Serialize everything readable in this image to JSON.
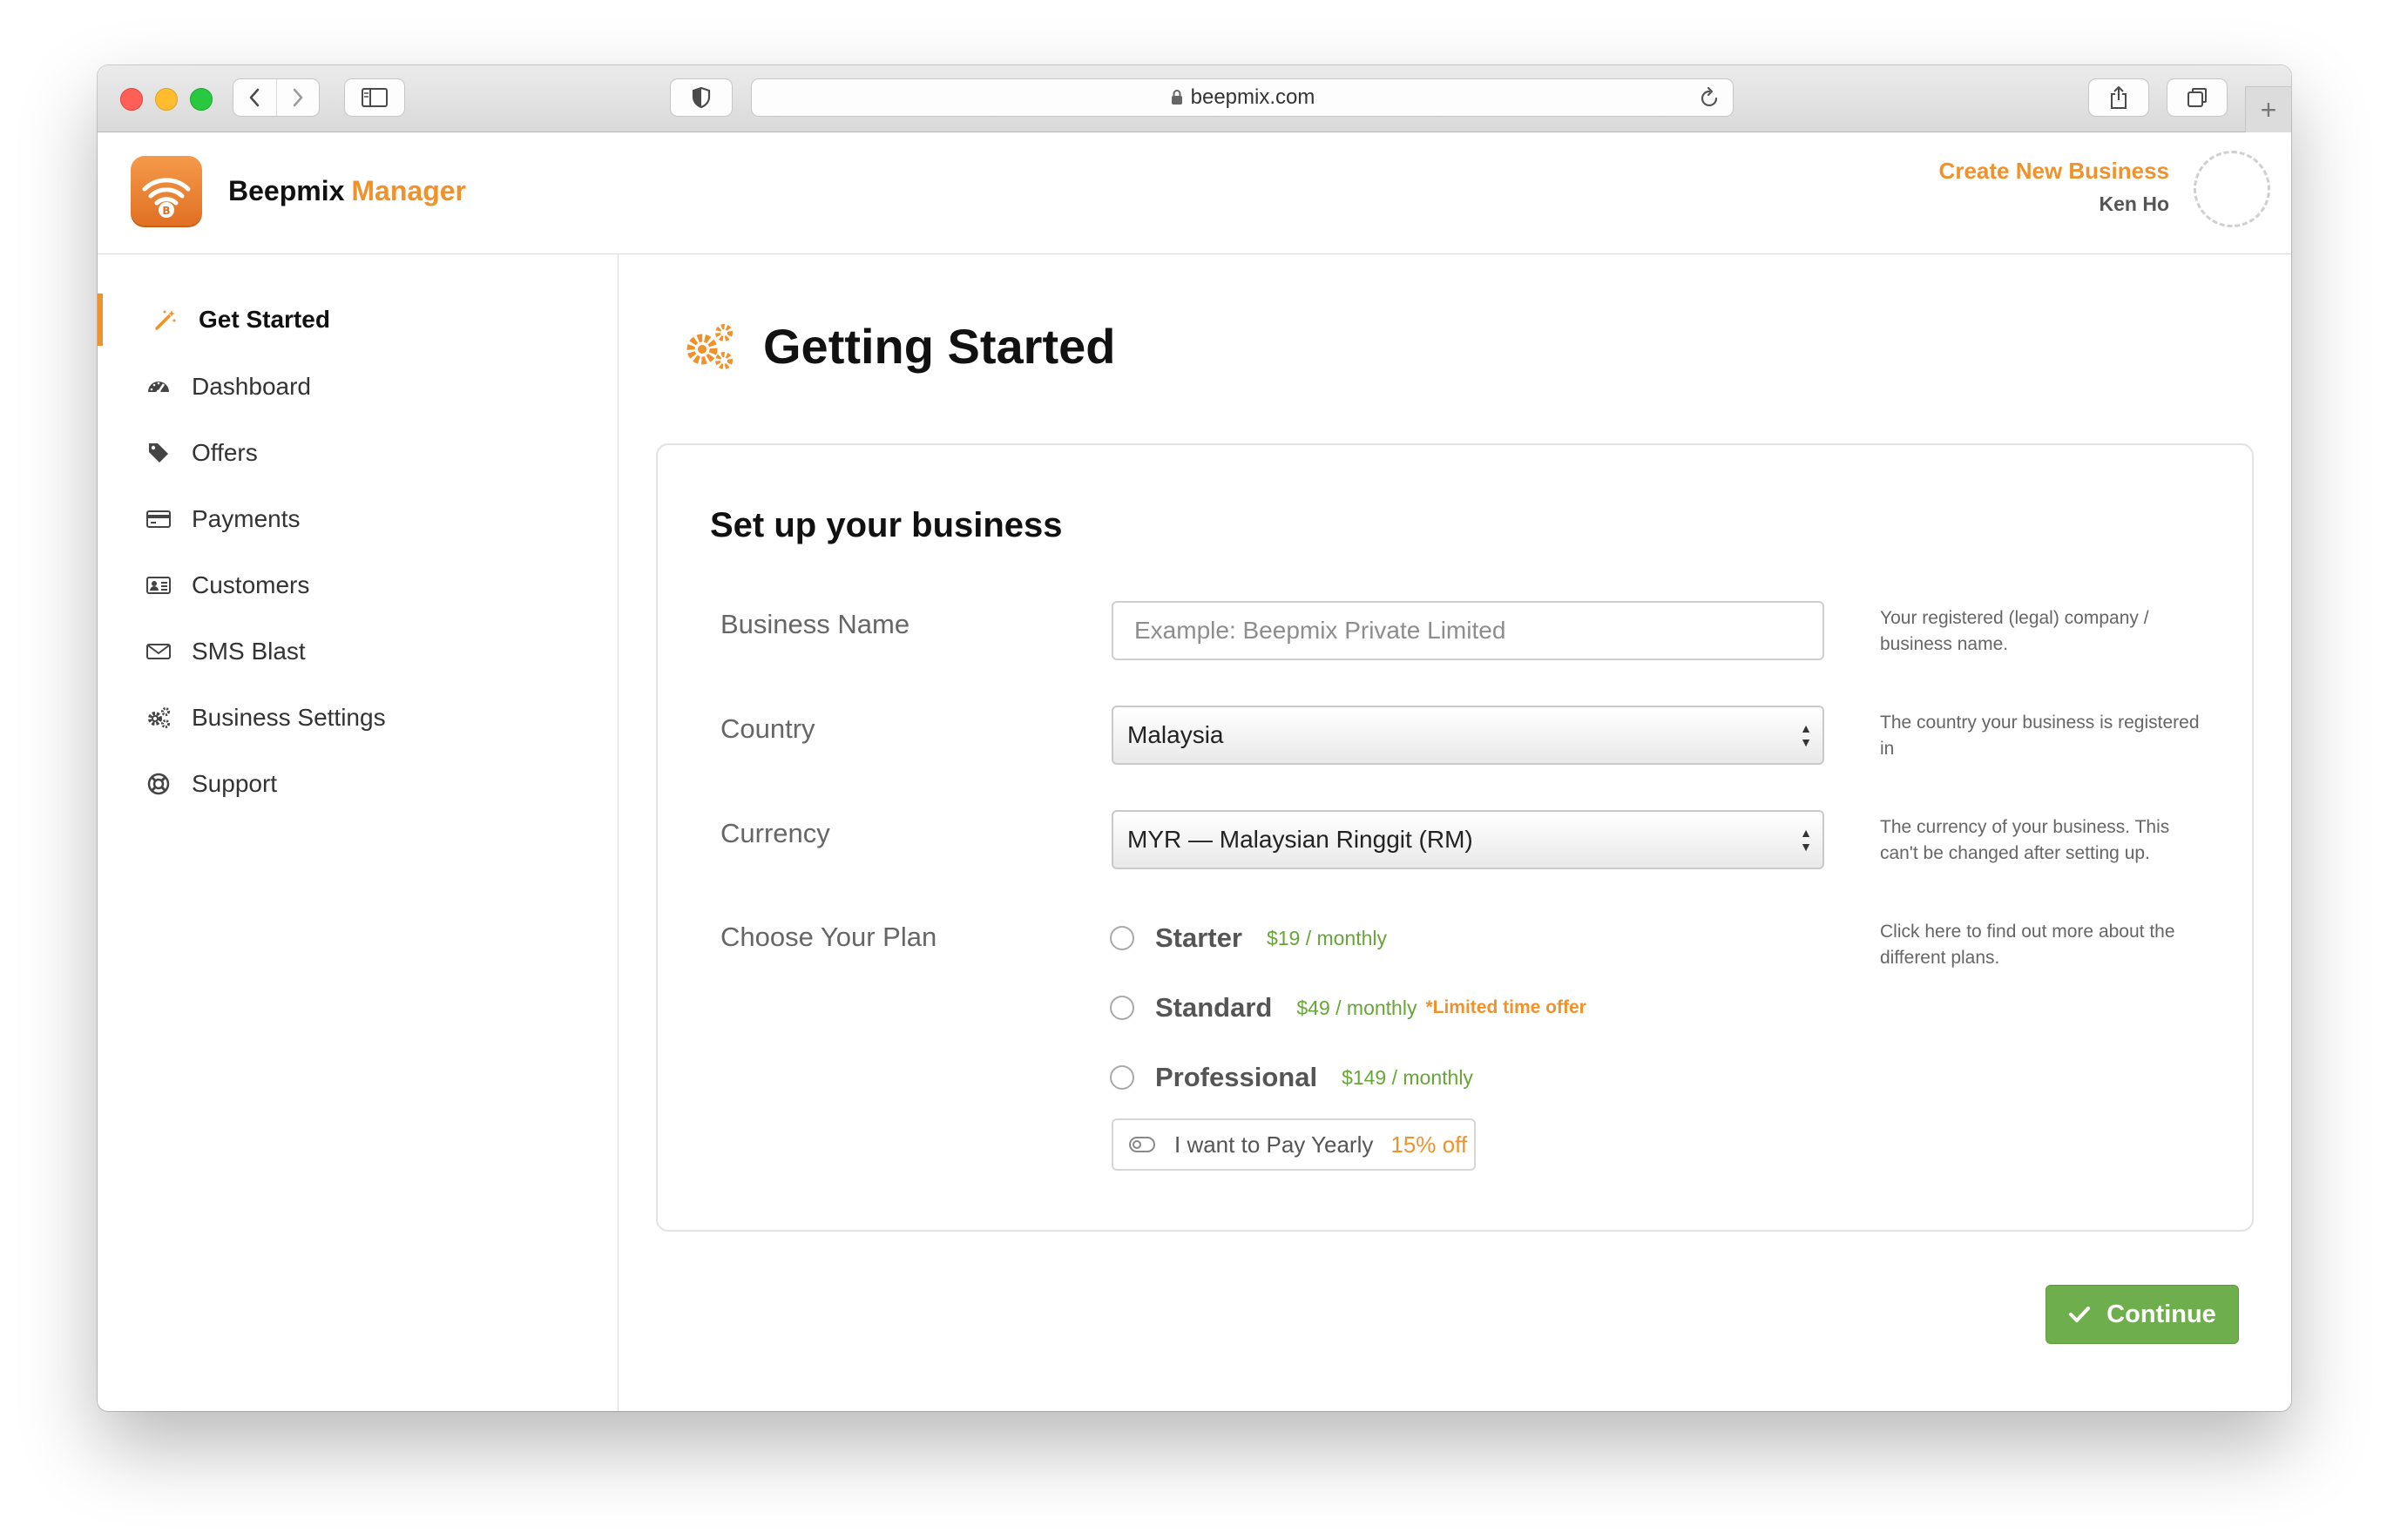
{
  "browser": {
    "url": "beepmix.com",
    "icons": {
      "back": "chevron-left-icon",
      "forward": "chevron-right-icon",
      "sidebar": "sidebar-icon",
      "privacy": "shield-icon",
      "lock": "lock-icon",
      "reload": "reload-icon",
      "share": "share-icon",
      "tabs": "tabs-icon",
      "new_tab": "plus-icon"
    }
  },
  "header": {
    "brand_name": "Beepmix",
    "brand_accent": "Manager",
    "create_business": "Create New Business",
    "user_name": "Ken Ho"
  },
  "sidebar": {
    "items": [
      {
        "label": "Get Started",
        "icon": "magic-wand-icon",
        "active": true
      },
      {
        "label": "Dashboard",
        "icon": "dashboard-gauge-icon"
      },
      {
        "label": "Offers",
        "icon": "tag-icon"
      },
      {
        "label": "Payments",
        "icon": "credit-card-icon"
      },
      {
        "label": "Customers",
        "icon": "id-card-icon"
      },
      {
        "label": "SMS Blast",
        "icon": "envelope-icon"
      },
      {
        "label": "Business Settings",
        "icon": "gears-icon"
      },
      {
        "label": "Support",
        "icon": "life-ring-icon"
      }
    ]
  },
  "main": {
    "title": "Getting Started",
    "card": {
      "title": "Set up your business",
      "business_name": {
        "label": "Business Name",
        "placeholder": "Example: Beepmix Private Limited",
        "value": "",
        "help": "Your registered (legal) company / business name."
      },
      "country": {
        "label": "Country",
        "value": "Malaysia",
        "help": "The country your business is registered in"
      },
      "currency": {
        "label": "Currency",
        "value": "MYR — Malaysian Ringgit (RM)",
        "help": "The currency of your business. This can't be changed after setting up."
      },
      "plan": {
        "label": "Choose Your Plan",
        "help": "Click here to find out more about the different plans.",
        "options": [
          {
            "name": "Starter",
            "price": "$19 / monthly",
            "offer": ""
          },
          {
            "name": "Standard",
            "price": "$49 / monthly",
            "offer": "*Limited time offer"
          },
          {
            "name": "Professional",
            "price": "$149 / monthly",
            "offer": ""
          }
        ],
        "yearly_label": "I want to Pay Yearly",
        "yearly_discount": "15% off"
      }
    },
    "continue_label": "Continue"
  },
  "colors": {
    "accent": "#f0922b",
    "success": "#6fae4c",
    "price_green": "#67a537"
  }
}
